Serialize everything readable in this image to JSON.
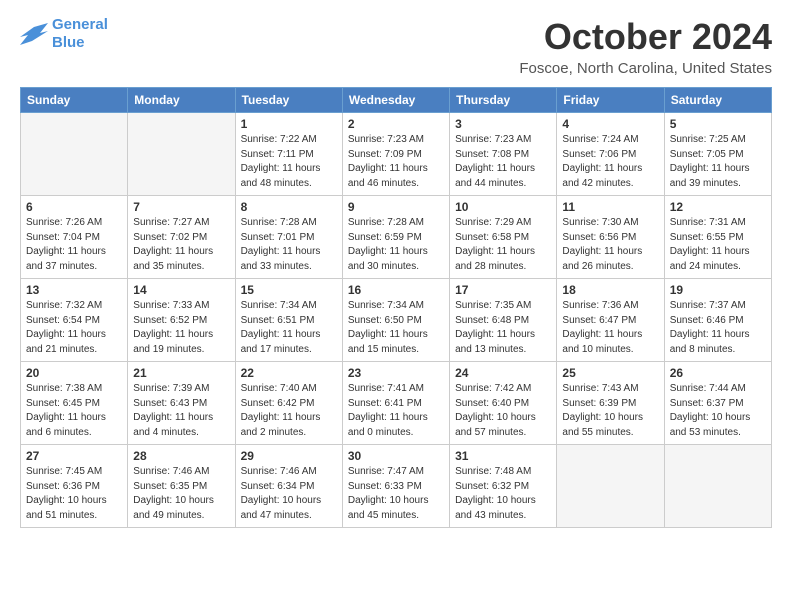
{
  "logo": {
    "line1": "General",
    "line2": "Blue"
  },
  "title": "October 2024",
  "subtitle": "Foscoe, North Carolina, United States",
  "weekdays": [
    "Sunday",
    "Monday",
    "Tuesday",
    "Wednesday",
    "Thursday",
    "Friday",
    "Saturday"
  ],
  "weeks": [
    [
      {
        "day": "",
        "info": ""
      },
      {
        "day": "",
        "info": ""
      },
      {
        "day": "1",
        "info": "Sunrise: 7:22 AM\nSunset: 7:11 PM\nDaylight: 11 hours and 48 minutes."
      },
      {
        "day": "2",
        "info": "Sunrise: 7:23 AM\nSunset: 7:09 PM\nDaylight: 11 hours and 46 minutes."
      },
      {
        "day": "3",
        "info": "Sunrise: 7:23 AM\nSunset: 7:08 PM\nDaylight: 11 hours and 44 minutes."
      },
      {
        "day": "4",
        "info": "Sunrise: 7:24 AM\nSunset: 7:06 PM\nDaylight: 11 hours and 42 minutes."
      },
      {
        "day": "5",
        "info": "Sunrise: 7:25 AM\nSunset: 7:05 PM\nDaylight: 11 hours and 39 minutes."
      }
    ],
    [
      {
        "day": "6",
        "info": "Sunrise: 7:26 AM\nSunset: 7:04 PM\nDaylight: 11 hours and 37 minutes."
      },
      {
        "day": "7",
        "info": "Sunrise: 7:27 AM\nSunset: 7:02 PM\nDaylight: 11 hours and 35 minutes."
      },
      {
        "day": "8",
        "info": "Sunrise: 7:28 AM\nSunset: 7:01 PM\nDaylight: 11 hours and 33 minutes."
      },
      {
        "day": "9",
        "info": "Sunrise: 7:28 AM\nSunset: 6:59 PM\nDaylight: 11 hours and 30 minutes."
      },
      {
        "day": "10",
        "info": "Sunrise: 7:29 AM\nSunset: 6:58 PM\nDaylight: 11 hours and 28 minutes."
      },
      {
        "day": "11",
        "info": "Sunrise: 7:30 AM\nSunset: 6:56 PM\nDaylight: 11 hours and 26 minutes."
      },
      {
        "day": "12",
        "info": "Sunrise: 7:31 AM\nSunset: 6:55 PM\nDaylight: 11 hours and 24 minutes."
      }
    ],
    [
      {
        "day": "13",
        "info": "Sunrise: 7:32 AM\nSunset: 6:54 PM\nDaylight: 11 hours and 21 minutes."
      },
      {
        "day": "14",
        "info": "Sunrise: 7:33 AM\nSunset: 6:52 PM\nDaylight: 11 hours and 19 minutes."
      },
      {
        "day": "15",
        "info": "Sunrise: 7:34 AM\nSunset: 6:51 PM\nDaylight: 11 hours and 17 minutes."
      },
      {
        "day": "16",
        "info": "Sunrise: 7:34 AM\nSunset: 6:50 PM\nDaylight: 11 hours and 15 minutes."
      },
      {
        "day": "17",
        "info": "Sunrise: 7:35 AM\nSunset: 6:48 PM\nDaylight: 11 hours and 13 minutes."
      },
      {
        "day": "18",
        "info": "Sunrise: 7:36 AM\nSunset: 6:47 PM\nDaylight: 11 hours and 10 minutes."
      },
      {
        "day": "19",
        "info": "Sunrise: 7:37 AM\nSunset: 6:46 PM\nDaylight: 11 hours and 8 minutes."
      }
    ],
    [
      {
        "day": "20",
        "info": "Sunrise: 7:38 AM\nSunset: 6:45 PM\nDaylight: 11 hours and 6 minutes."
      },
      {
        "day": "21",
        "info": "Sunrise: 7:39 AM\nSunset: 6:43 PM\nDaylight: 11 hours and 4 minutes."
      },
      {
        "day": "22",
        "info": "Sunrise: 7:40 AM\nSunset: 6:42 PM\nDaylight: 11 hours and 2 minutes."
      },
      {
        "day": "23",
        "info": "Sunrise: 7:41 AM\nSunset: 6:41 PM\nDaylight: 11 hours and 0 minutes."
      },
      {
        "day": "24",
        "info": "Sunrise: 7:42 AM\nSunset: 6:40 PM\nDaylight: 10 hours and 57 minutes."
      },
      {
        "day": "25",
        "info": "Sunrise: 7:43 AM\nSunset: 6:39 PM\nDaylight: 10 hours and 55 minutes."
      },
      {
        "day": "26",
        "info": "Sunrise: 7:44 AM\nSunset: 6:37 PM\nDaylight: 10 hours and 53 minutes."
      }
    ],
    [
      {
        "day": "27",
        "info": "Sunrise: 7:45 AM\nSunset: 6:36 PM\nDaylight: 10 hours and 51 minutes."
      },
      {
        "day": "28",
        "info": "Sunrise: 7:46 AM\nSunset: 6:35 PM\nDaylight: 10 hours and 49 minutes."
      },
      {
        "day": "29",
        "info": "Sunrise: 7:46 AM\nSunset: 6:34 PM\nDaylight: 10 hours and 47 minutes."
      },
      {
        "day": "30",
        "info": "Sunrise: 7:47 AM\nSunset: 6:33 PM\nDaylight: 10 hours and 45 minutes."
      },
      {
        "day": "31",
        "info": "Sunrise: 7:48 AM\nSunset: 6:32 PM\nDaylight: 10 hours and 43 minutes."
      },
      {
        "day": "",
        "info": ""
      },
      {
        "day": "",
        "info": ""
      }
    ]
  ]
}
